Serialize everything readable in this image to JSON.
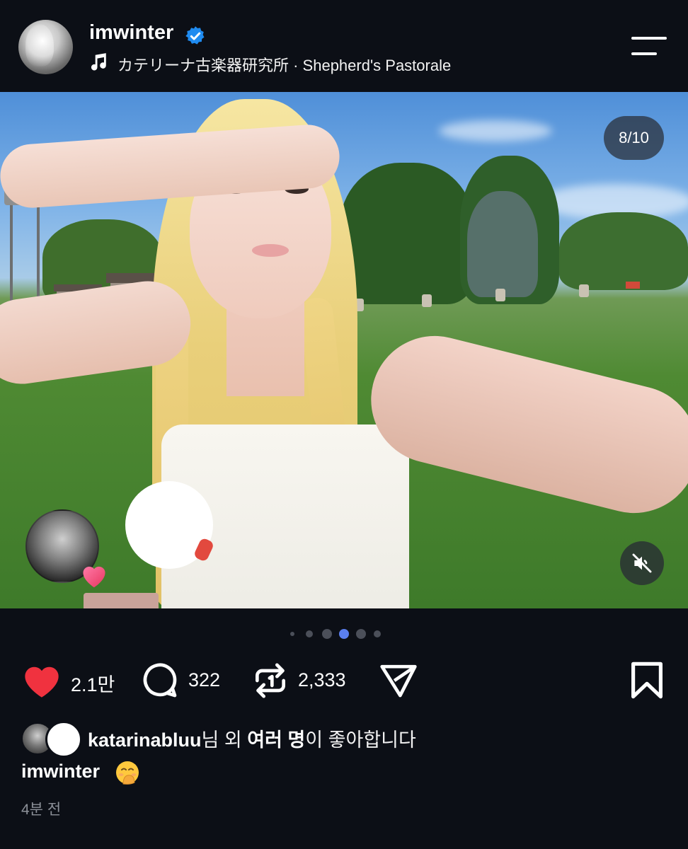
{
  "header": {
    "username": "imwinter",
    "music": "カテリーナ古楽器研究所 · Shepherd's Pastorale",
    "colors": {
      "verified": "#1f8bf0"
    }
  },
  "photo": {
    "counter": "8/10",
    "current_index": 8,
    "total": 10,
    "icons": [
      "mute-icon",
      "heart-icon"
    ]
  },
  "carousel": {
    "dot_count": 6,
    "active_dot": 3,
    "active_color": "#5a7ff0"
  },
  "actions": {
    "likes": "2.1만",
    "comments": "322",
    "reposts": "2,333",
    "like_color": "#f0323f"
  },
  "footer": {
    "liked_by_user": "katarinabluu",
    "liked_by_middle": "님 외 ",
    "liked_by_bold": "여러 명",
    "liked_by_suffix": "이 좋아합니다",
    "caption_user": "imwinter",
    "timestamp": "4분 전"
  }
}
